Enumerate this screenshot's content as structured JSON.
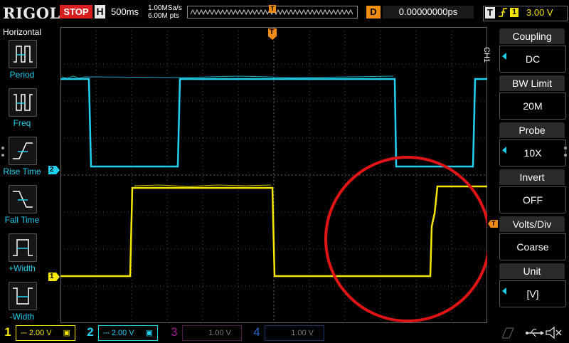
{
  "top": {
    "logo": "RIGOL",
    "run_state": "STOP",
    "h_label": "H",
    "timebase": "500ms",
    "sample_rate": "1.00MSa/s",
    "memory_depth": "6.00M pts",
    "trigger_pos_marker": "T",
    "delay_label": "D",
    "delay_value": "0.00000000ps",
    "trigger_label": "T",
    "trigger_edge": "rising",
    "trigger_source": "1",
    "trigger_level": "3.00 V"
  },
  "left_panel": {
    "title": "Horizontal",
    "items": [
      {
        "label": "Period",
        "icon": "period-icon"
      },
      {
        "label": "Freq",
        "icon": "freq-icon"
      },
      {
        "label": "Rise Time",
        "icon": "rise-time-icon"
      },
      {
        "label": "Fall Time",
        "icon": "fall-time-icon"
      },
      {
        "label": "+Width",
        "icon": "pos-width-icon"
      },
      {
        "label": "-Width",
        "icon": "neg-width-icon"
      }
    ]
  },
  "right_panel": {
    "channel_tag": "CH1",
    "items": [
      {
        "title": "Coupling",
        "value": "DC",
        "has_arrow": true
      },
      {
        "title": "BW Limit",
        "value": "20M",
        "has_arrow": false
      },
      {
        "title": "Probe",
        "value": "10X",
        "has_arrow": true
      },
      {
        "title": "Invert",
        "value": "OFF",
        "has_arrow": false
      },
      {
        "title": "Volts/Div",
        "value": "Coarse",
        "has_arrow": false
      },
      {
        "title": "Unit",
        "value": "[V]",
        "has_arrow": true
      }
    ]
  },
  "markers": {
    "ch1": "1",
    "ch2": "2",
    "trigger_level_marker": "T"
  },
  "bottom": {
    "channels": [
      {
        "num": "1",
        "scale": "2.00 V",
        "color": "#f5e600",
        "active": true
      },
      {
        "num": "2",
        "scale": "2.00 V",
        "color": "#22d0f0",
        "active": true
      },
      {
        "num": "3",
        "scale": "1.00 V",
        "color": "#a01a8c",
        "active": false
      },
      {
        "num": "4",
        "scale": "1.00 V",
        "color": "#2a64c8",
        "active": false
      }
    ]
  },
  "colors": {
    "ch1": "#f5e600",
    "ch2": "#22d0f0",
    "accent": "#f08c14",
    "stop": "#d81e1e",
    "annotation": "#e01414"
  }
}
